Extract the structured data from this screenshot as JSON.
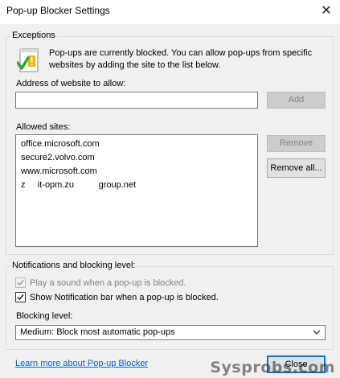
{
  "window": {
    "title": "Pop-up Blocker Settings",
    "close_glyph": "✕"
  },
  "exceptions": {
    "legend": "Exceptions",
    "info_text": "Pop-ups are currently blocked.  You can allow pop-ups from specific websites by adding the site to the list below.",
    "address_label": "Address of website to allow:",
    "address_value": "",
    "add_label": "Add",
    "allowed_label": "Allowed sites:",
    "allowed_sites": [
      "office.microsoft.com",
      "secure2.volvo.com",
      "www.microsoft.com",
      "z     it-opm.zu          group.net"
    ],
    "remove_label": "Remove",
    "remove_all_label": "Remove all..."
  },
  "notifications": {
    "legend": "Notifications and blocking level:",
    "play_sound_label": "Play a sound when a pop-up is blocked.",
    "play_sound_checked": true,
    "play_sound_enabled": false,
    "show_bar_label": "Show Notification bar when a pop-up is blocked.",
    "show_bar_checked": true,
    "blocking_level_label": "Blocking level:",
    "blocking_level_value": "Medium: Block most automatic pop-ups"
  },
  "footer": {
    "learn_more_link": "Learn more about Pop-up Blocker",
    "close_label": "Close"
  },
  "watermark": "Sysprobs.com",
  "colors": {
    "link": "#0066cc",
    "default_button_border": "#0078d7"
  }
}
